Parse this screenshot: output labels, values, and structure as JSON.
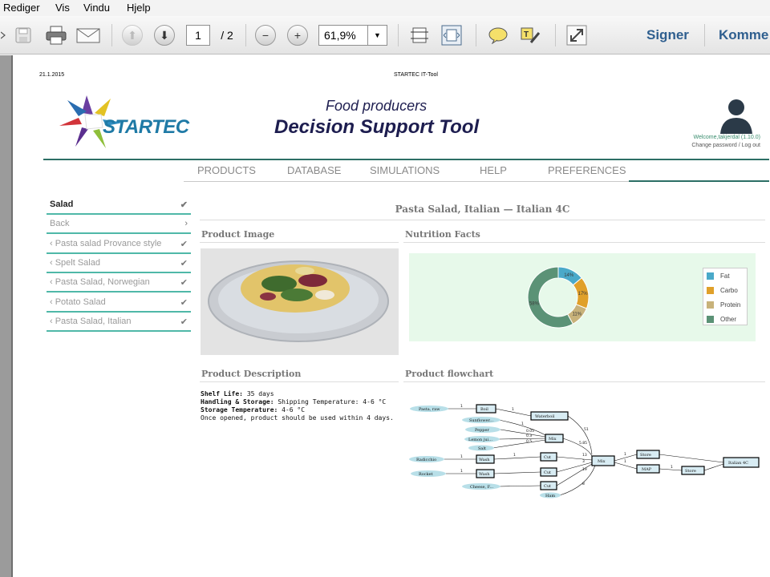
{
  "menubar": {
    "items": [
      "Rediger",
      "Vis",
      "Vindu",
      "Hjelp"
    ]
  },
  "toolbar": {
    "page_current": "1",
    "page_total": "/ 2",
    "zoom": "61,9%",
    "sign_label": "Signer",
    "comment_label": "Komme"
  },
  "doc": {
    "date": "21.1.2015",
    "tool_name": "STARTEC IT-Tool",
    "logo_text": "STARTEC",
    "header_sub": "Food producers",
    "header_title": "Decision Support Tool",
    "welcome_prefix": "Welcome,",
    "welcome_user": "takjerdal (1.10.0)",
    "change_links": "Change password / Log out",
    "nav": [
      "PRODUCTS",
      "DATABASE",
      "SIMULATIONS",
      "HELP",
      "PREFERENCES"
    ],
    "sidebar": [
      {
        "label": "Salad",
        "mark": "✔"
      },
      {
        "label": "Back",
        "mark": "›"
      },
      {
        "label": "‹ Pasta salad Provance style",
        "mark": "✔"
      },
      {
        "label": "‹ Spelt Salad",
        "mark": "✔"
      },
      {
        "label": "‹ Pasta Salad, Norwegian",
        "mark": "✔"
      },
      {
        "label": "‹ Potato Salad",
        "mark": "✔"
      },
      {
        "label": "‹ Pasta Salad, Italian",
        "mark": "✔"
      }
    ],
    "product_title": "Pasta Salad, Italian — Italian 4C",
    "sections": {
      "image": "Product Image",
      "nutrition": "Nutrition Facts",
      "description": "Product Description",
      "flowchart": "Product flowchart"
    },
    "description": {
      "shelf_label": "Shelf Life:",
      "shelf_value": "35 days",
      "handling_label": "Handling & Storage:",
      "handling_value": "Shipping Temperature: 4-6 °C",
      "storage_label": "Storage Temperature:",
      "storage_value": "4-6 °C",
      "note": "Once opened, product should be used within 4 days."
    }
  },
  "chart_data": {
    "type": "pie",
    "categories": [
      "Fat",
      "Carbo",
      "Protein",
      "Other"
    ],
    "values": [
      14,
      17,
      11,
      58
    ],
    "labels": [
      "14%",
      "17%",
      "11%",
      "58%"
    ],
    "colors": [
      "#4aa9c9",
      "#e0a02a",
      "#c8b27a",
      "#5b9276"
    ],
    "legend_position": "right"
  },
  "flowchart": {
    "nodes": [
      "Pasta, raw",
      "Boil",
      "Waterboil",
      "Sunflower...",
      "Pepper",
      "Lemon jui...",
      "Salt",
      "Mix",
      "Radicchio",
      "Wash",
      "Cut",
      "Rocket",
      "Cheese, F...",
      "Ham",
      "Mix",
      "Store",
      "MAP",
      "Store",
      "Italian 4C"
    ],
    "edge_labels": [
      "1",
      "1",
      "1",
      "51",
      "0.05",
      "0.3",
      "0.5",
      "5.85",
      "1",
      "13",
      "1",
      "3",
      "1",
      "19",
      "8",
      "1",
      "1",
      "1"
    ]
  }
}
